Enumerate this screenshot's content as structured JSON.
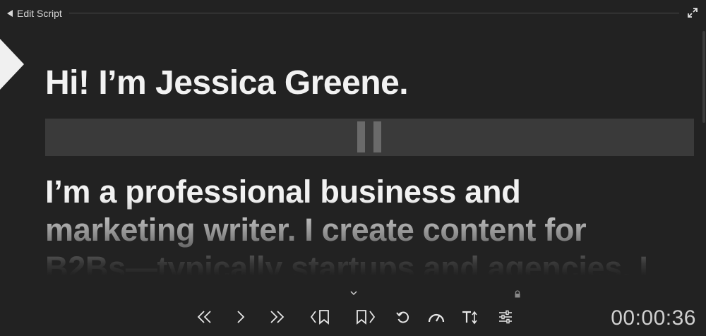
{
  "header": {
    "back_label": "Edit Script"
  },
  "script": {
    "headline": "Hi! I’m Jessica Greene.",
    "body_lines": [
      "I’m a professional business and",
      "marketing writer. I create content for",
      "B2Bs—typically startups and agencies. I"
    ]
  },
  "controls": {
    "icons": [
      "rewind-icon",
      "step-forward-icon",
      "fast-forward-icon",
      "previous-bookmark-icon",
      "next-bookmark-icon",
      "reset-icon",
      "speed-icon",
      "text-size-icon",
      "settings-sliders-icon"
    ]
  },
  "timer": {
    "elapsed": "00:00:36"
  },
  "colors": {
    "background": "#222222",
    "text": "#f2f2f2",
    "pause_bar": "#3a3a3a",
    "pause_icon": "#6a6a6a"
  }
}
